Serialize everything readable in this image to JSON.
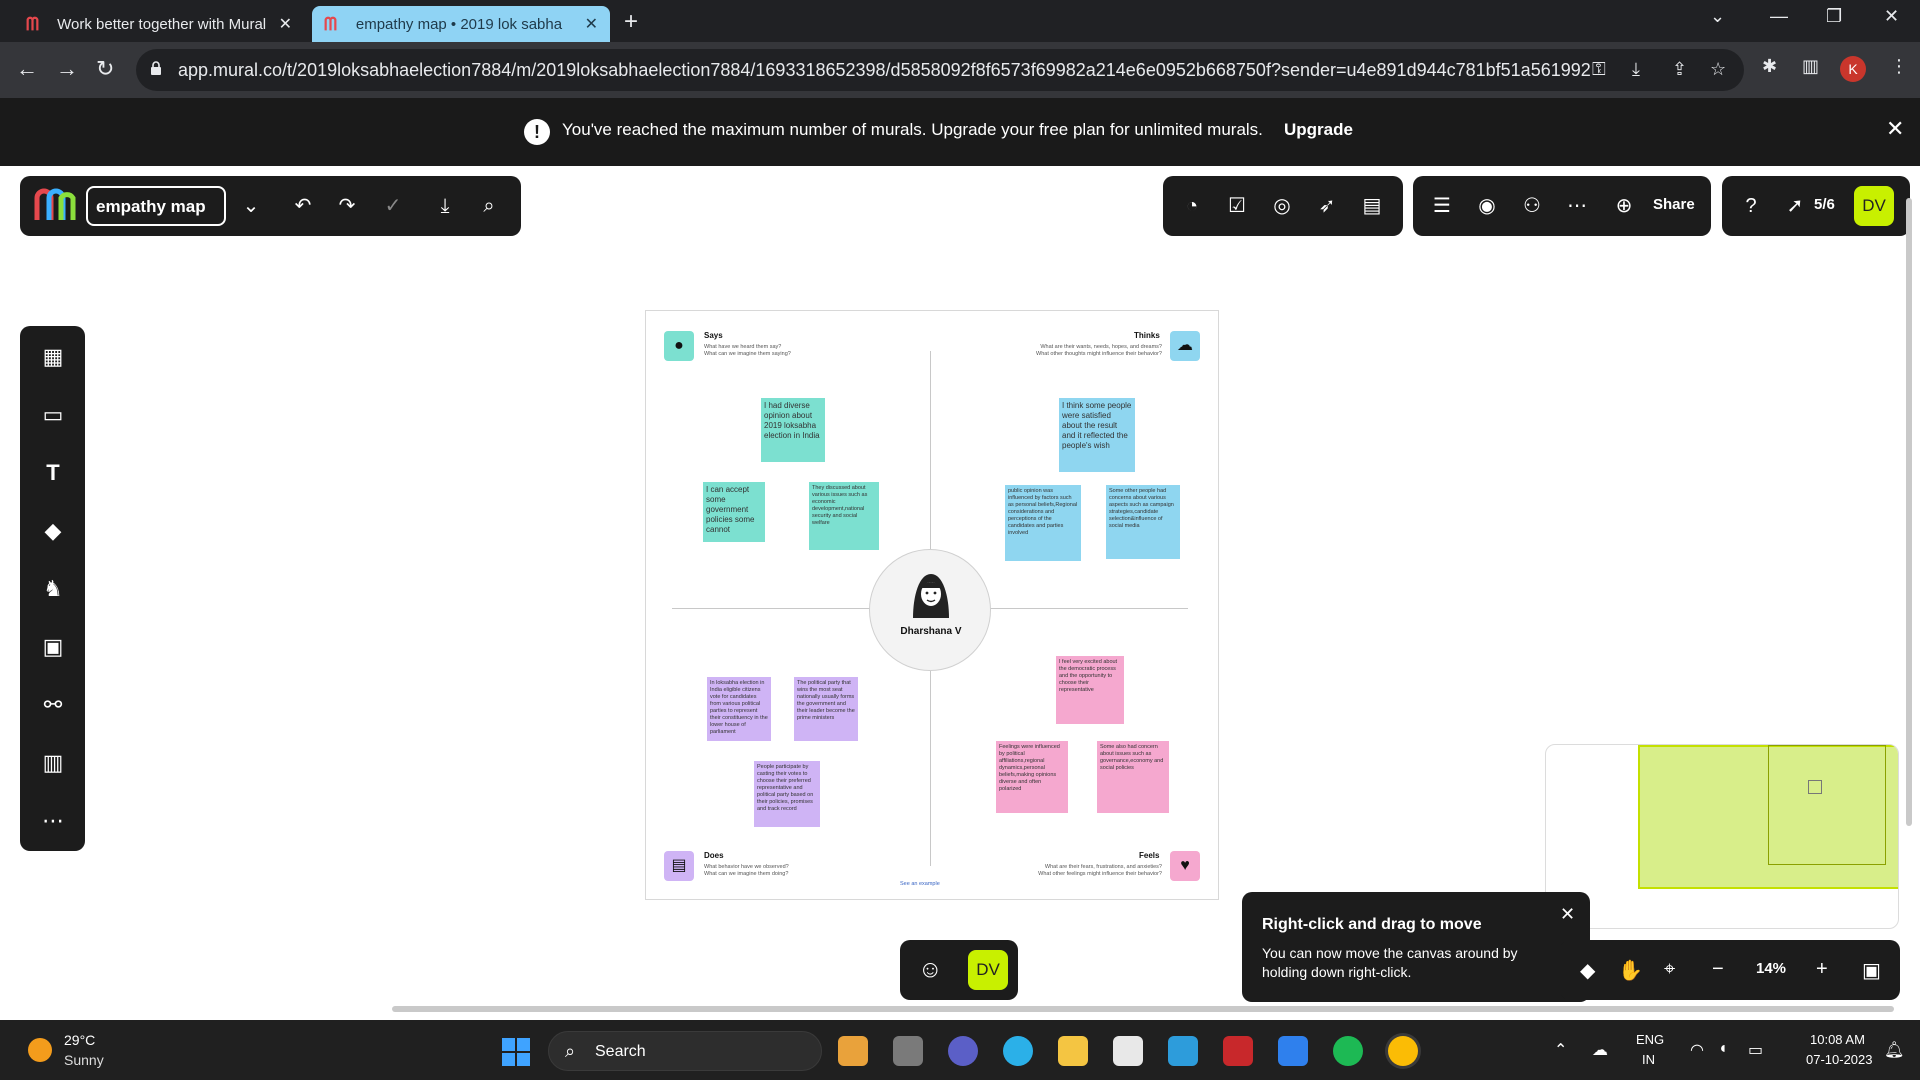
{
  "browser": {
    "tabs": [
      {
        "title": "Work better together with Mural",
        "active": false
      },
      {
        "title": "empathy map • 2019 lok sabha",
        "active": true
      }
    ],
    "url": "app.mural.co/t/2019loksabhaelection7884/m/2019loksabhaelection7884/1693318652398/d5858092f8f6573f69982a214e6e0952b668750f?sender=u4e891d944c781bf51a561992",
    "profile_initial": "K"
  },
  "banner": {
    "message": "You've reached the maximum number of murals. Upgrade your free plan for unlimited murals.",
    "upgrade": "Upgrade"
  },
  "toolbar": {
    "mural_title": "empathy map",
    "share": "Share",
    "member_count": "5/6",
    "user_initials": "DV"
  },
  "canvas": {
    "persona_name": "Dharshana V",
    "see_example": "See an example",
    "quadrants": {
      "says": {
        "title": "Says",
        "sub1": "What have we heard them say?",
        "sub2": "What can we imagine them saying?"
      },
      "thinks": {
        "title": "Thinks",
        "sub1": "What are their wants, needs, hopes, and dreams?",
        "sub2": "What other thoughts might influence their behavior?"
      },
      "does": {
        "title": "Does",
        "sub1": "What behavior have we observed?",
        "sub2": "What can we imagine them doing?"
      },
      "feels": {
        "title": "Feels",
        "sub1": "What are their fears, frustrations, and anxieties?",
        "sub2": "What other feelings might influence their behavior?"
      }
    },
    "stickies": {
      "says1": "I had diverse opinion about 2019 loksabha election in India",
      "says2": "I can accept some government policies some cannot",
      "says3": "They discussed about various issues such as economic development,national security and social welfare",
      "thinks1": "I think some people were satisfied about the result and it reflected the people's wish",
      "thinks2": "public opinion was influenced by factors such as personal beliefs,Regional considerations and perceptions of the candidates and parties involved",
      "thinks3": "Some other people had concerns about various aspects such as campaign strategies,candidate selection&influence of social media",
      "does1": "In loksabha election in India eligible citizens vote for candidates from various political parties to represent their constituency in the lower house of parliament",
      "does2": "The political party that wins the most seat nationally usually forms the government and their leader become the prime ministers",
      "does3": "People participate by casting their votes to choose their preferred representative and political party based on their policies, promises and track record",
      "feels1": "I feel very excited about the democratic process and the opportunity to choose their representative",
      "feels2": "Feelings were influenced by political affiliations,regional dynamics,personal beliefs,making opinions diverse and often polarized",
      "feels3": "Some also had concern about issues such as governance,economy and social policies"
    }
  },
  "tip": {
    "title": "Right-click and drag to move",
    "body": "You can now move the canvas around by holding down right-click."
  },
  "zoom": {
    "level": "14%"
  },
  "taskbar": {
    "temperature": "29°C",
    "condition": "Sunny",
    "search": "Search",
    "lang1": "ENG",
    "lang2": "IN",
    "time": "10:08 AM",
    "date": "07-10-2023"
  },
  "colors": {
    "teal_sticky": "#7ce0d0",
    "blue_sticky": "#8fd6f0",
    "purple_sticky": "#cfb4f5",
    "pink_sticky": "#f5a8cf",
    "user_accent": "#c8f000",
    "toolbar_bg": "#1c1c1c"
  }
}
